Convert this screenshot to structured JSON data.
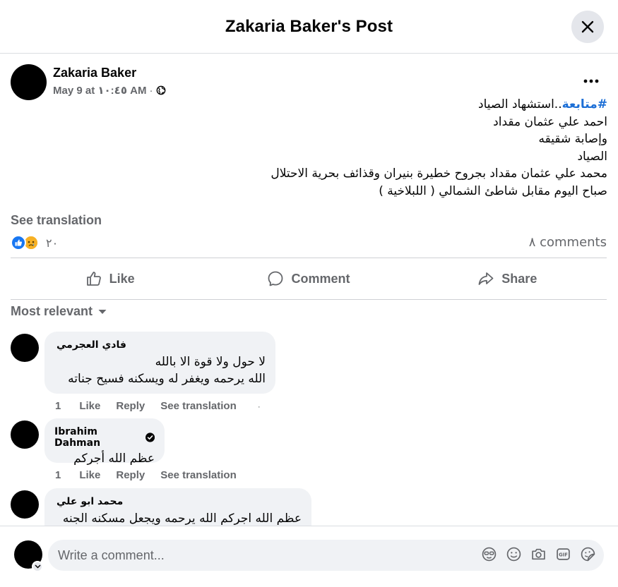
{
  "header": {
    "title": "Zakaria Baker's Post"
  },
  "post": {
    "author": "Zakaria Baker",
    "meta_time": "May 9 at ١٠:٤٥ AM",
    "meta_dot": "·",
    "hashtag": "#متابعة",
    "lines": [
      "..استشهاد الصياد",
      "احمد علي عثمان مقداد",
      "وإصابة  شقيقه",
      "الصياد",
      "محمد علي عثمان مقداد بجروح خطيرة بنيران وقذائف بحرية الاحتلال",
      "صباح اليوم مقابل شاطئ الشمالي ( اللبلاخية )"
    ],
    "see_translation": "See translation",
    "reaction_count": "٢٠",
    "comments_count": "٨ comments"
  },
  "actions": {
    "like": "Like",
    "comment": "Comment",
    "share": "Share"
  },
  "sort_label": "Most relevant",
  "comments": [
    {
      "author": "فادي العجرمي",
      "lines": [
        "لا حول ولا قوة الا بالله",
        "الله يرحمه ويغفر له ويسكنه فسيح جناته"
      ],
      "time": "1",
      "like": "Like",
      "reply": "Reply",
      "translate": "See translation",
      "dot": "·"
    },
    {
      "author": "Ibrahim Dahman",
      "verified": true,
      "lines": [
        "عظم الله أجركم"
      ],
      "time": "1",
      "like": "Like",
      "reply": "Reply",
      "translate": "See translation",
      "dot": ""
    },
    {
      "author": "محمد ابو علي",
      "lines": [
        "عظم الله اجركم الله يرحمه ويجعل مسكنه الجنه"
      ]
    }
  ],
  "composer": {
    "placeholder": "Write a comment..."
  },
  "colors": {
    "accent": "#1877f2",
    "hashtag": "#1d6fd6",
    "muted": "#65676b",
    "bubble": "#f0f2f5"
  }
}
